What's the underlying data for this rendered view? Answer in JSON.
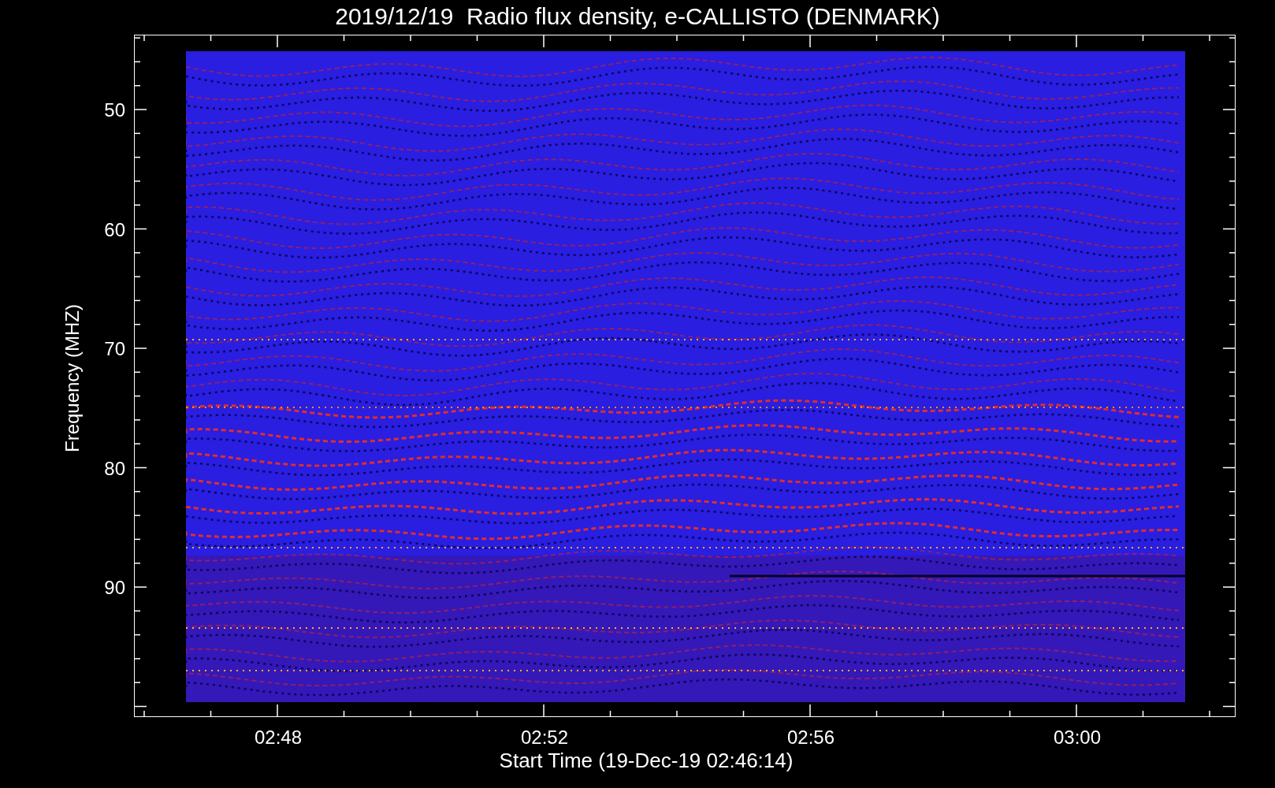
{
  "title": "2019/12/19  Radio flux density, e-CALLISTO (DENMARK)",
  "y_axis": {
    "label": "Frequency (MHZ)",
    "ticks": [
      "50",
      "60",
      "70",
      "80",
      "90"
    ]
  },
  "x_axis": {
    "label": "Start Time (19-Dec-19 02:46:14)",
    "ticks": [
      "02:48",
      "02:52",
      "02:56",
      "03:00"
    ]
  }
}
